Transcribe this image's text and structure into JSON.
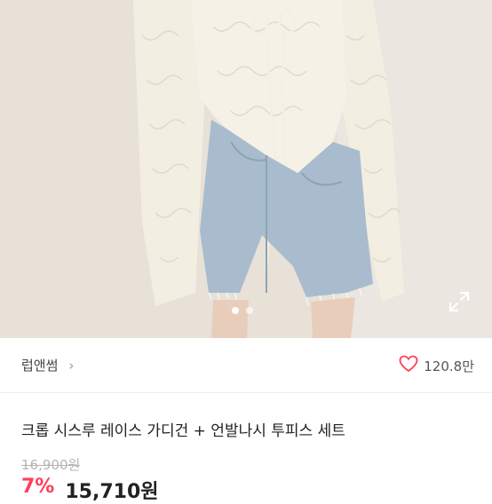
{
  "product": {
    "image_alt": "크롭 시스루 레이스 가디건 + 언발나시 투피스 세트",
    "image_count": 2,
    "current_image": 1
  },
  "store": {
    "name": "럽앤썸",
    "chevron": "›"
  },
  "likes": {
    "count": "120.8만",
    "icon": "heart-icon"
  },
  "title": "크롭 시스루 레이스 가디건 + 언발나시 투피스 세트",
  "pricing": {
    "original": "16,900원",
    "discount": "7%",
    "final": "15,710원"
  },
  "colors": {
    "accent": "#ff3e59",
    "text": "#222222",
    "muted": "#b5b5b5"
  }
}
